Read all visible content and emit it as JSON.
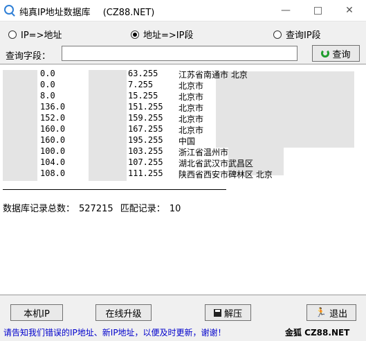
{
  "window": {
    "title": "纯真IP地址数据库",
    "title_suffix": "(CZ88.NET)",
    "min_label": "—",
    "close_label": "✕"
  },
  "modes": [
    {
      "label": "IP=>地址",
      "selected": false
    },
    {
      "label": "地址=>IP段",
      "selected": true
    },
    {
      "label": "查询IP段",
      "selected": false
    }
  ],
  "query": {
    "label": "查询字段：",
    "value": "",
    "button_label": "查询"
  },
  "results": [
    {
      "start": "0.0",
      "end": "63.255",
      "location": "江苏省南通市 北京"
    },
    {
      "start": "0.0",
      "end": "7.255",
      "location": "北京市"
    },
    {
      "start": "8.0",
      "end": "15.255",
      "location": "北京市"
    },
    {
      "start": "136.0",
      "end": "151.255",
      "location": "北京市"
    },
    {
      "start": "152.0",
      "end": "159.255",
      "location": "北京市"
    },
    {
      "start": "160.0",
      "end": "167.255",
      "location": "北京市"
    },
    {
      "start": "160.0",
      "end": "195.255",
      "location": "中国"
    },
    {
      "start": "100.0",
      "end": "103.255",
      "location": "浙江省温州市"
    },
    {
      "start": "104.0",
      "end": "107.255",
      "location": "湖北省武汉市武昌区"
    },
    {
      "start": "108.0",
      "end": "111.255",
      "location": "陕西省西安市碑林区 北京"
    }
  ],
  "stats": {
    "total_label": "数据库记录总数：",
    "total_value": "527215",
    "match_label": "匹配记录：",
    "match_value": "10"
  },
  "buttons": {
    "local_ip": "本机IP",
    "online_upgrade": "在线升级",
    "extract": "解压",
    "exit": "退出"
  },
  "footer": {
    "notice": "请告知我们错误的IP地址、新IP地址，以便及时更新，谢谢！",
    "brand": "金狐 CZ88.NET"
  }
}
